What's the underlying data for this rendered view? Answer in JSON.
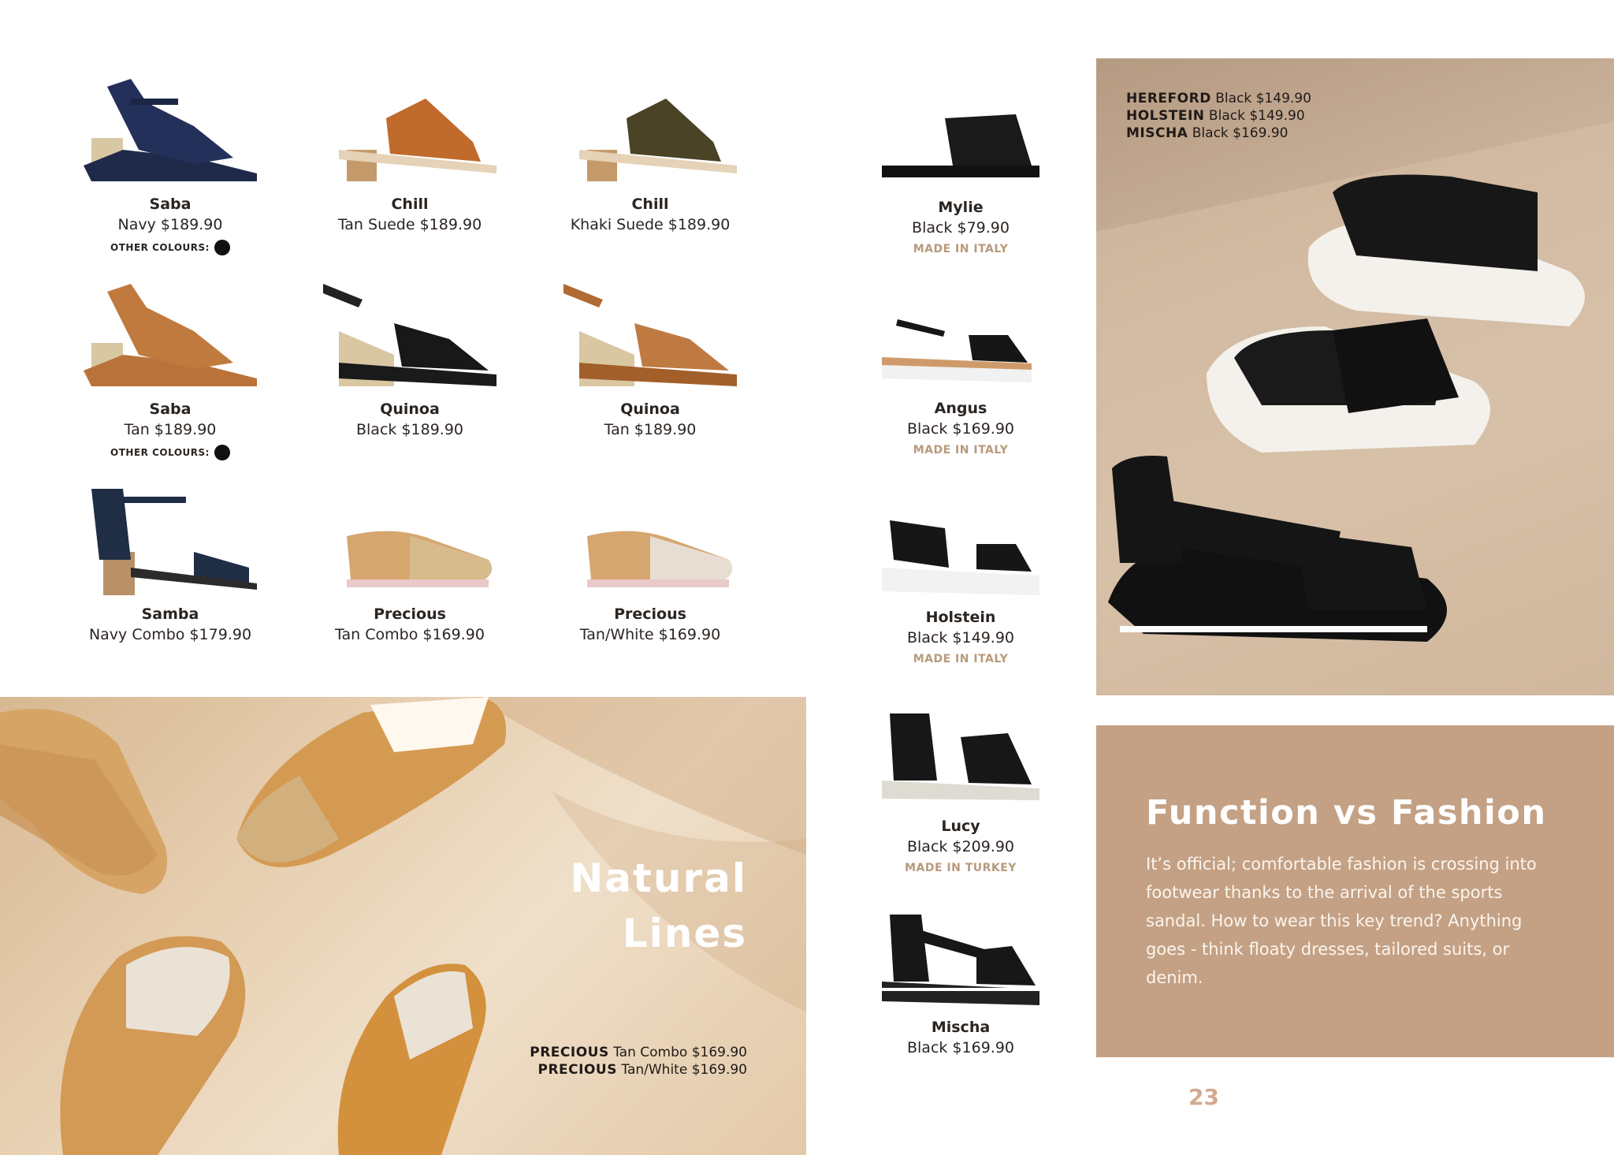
{
  "products": [
    {
      "name": "Saba",
      "desc": "Navy $189.90",
      "other_label": "OTHER COLOURS:"
    },
    {
      "name": "Chill",
      "desc": "Tan Suede $189.90"
    },
    {
      "name": "Chill",
      "desc": "Khaki Suede $189.90"
    },
    {
      "name": "Saba",
      "desc": "Tan $189.90",
      "other_label": "OTHER COLOURS:"
    },
    {
      "name": "Quinoa",
      "desc": "Black $189.90"
    },
    {
      "name": "Quinoa",
      "desc": "Tan $189.90"
    },
    {
      "name": "Samba",
      "desc": "Navy Combo $179.90"
    },
    {
      "name": "Precious",
      "desc": "Tan Combo $169.90"
    },
    {
      "name": "Precious",
      "desc": "Tan/White $169.90"
    }
  ],
  "right_column": [
    {
      "name": "Mylie",
      "desc": "Black $79.90",
      "made": "MADE IN ITALY"
    },
    {
      "name": "Angus",
      "desc": "Black $169.90",
      "made": "MADE IN ITALY"
    },
    {
      "name": "Holstein",
      "desc": "Black $149.90",
      "made": "MADE IN ITALY"
    },
    {
      "name": "Lucy",
      "desc": "Black $209.90",
      "made": "MADE IN TURKEY"
    },
    {
      "name": "Mischa",
      "desc": "Black $169.90"
    }
  ],
  "top_photo_caption": [
    {
      "bold": "HEREFORD",
      "rest": " Black $149.90"
    },
    {
      "bold": "HOLSTEIN",
      "rest": " Black $149.90"
    },
    {
      "bold": "MISCHA",
      "rest": " Black $169.90"
    }
  ],
  "natural_lines": {
    "line1": "Natural",
    "line2": "Lines"
  },
  "bottom_photo_caption": [
    {
      "bold": "PRECIOUS",
      "rest": " Tan Combo $169.90"
    },
    {
      "bold": "PRECIOUS",
      "rest": " Tan/White $169.90"
    }
  ],
  "feature": {
    "heading": "Function vs Fashion",
    "body": "It’s official; comfortable fashion is crossing into footwear thanks to the arrival of the sports sandal. How to wear this key trend? Anything goes - think floaty dresses, tailored suits, or denim."
  },
  "page_number": "23",
  "colors": {
    "made_label": "#b79a7c",
    "box": "#c4a184",
    "page_number": "#d2aa8f"
  }
}
